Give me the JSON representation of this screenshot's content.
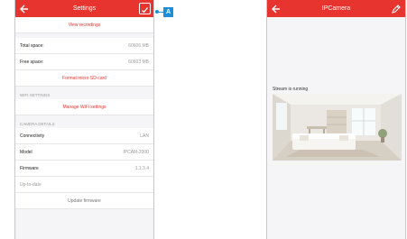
{
  "settings_screen": {
    "title": "Settings",
    "view_recordings": "View recordings",
    "storage": [
      {
        "label": "Total space:",
        "value": "60606 MB"
      },
      {
        "label": "Free space:",
        "value": "60603 MB"
      }
    ],
    "format_label": "Format micro SD card",
    "wifi_header": "WIFI SETTINGS",
    "manage_wifi": "Manage WiFi settings",
    "camera_header": "CAMERA DETAILS",
    "details": [
      {
        "label": "Connectivity",
        "value": "LAN"
      },
      {
        "label": "Model",
        "value": "IPCAM-2000"
      },
      {
        "label": "Firmware",
        "value": "1.1.3.4"
      }
    ],
    "up_to_date": "Up-to-date",
    "update_firmware": "Update firmware"
  },
  "callout": {
    "label": "A",
    "color": "#1c8fd6"
  },
  "camera_screen": {
    "title": "IPCamera",
    "stream_status": "Stream is running"
  },
  "colors": {
    "accent": "#e8342e",
    "background": "#f5f5f7"
  },
  "icons": {
    "back": "back-arrow-icon",
    "confirm": "checkbox-icon",
    "edit": "pencil-icon"
  }
}
